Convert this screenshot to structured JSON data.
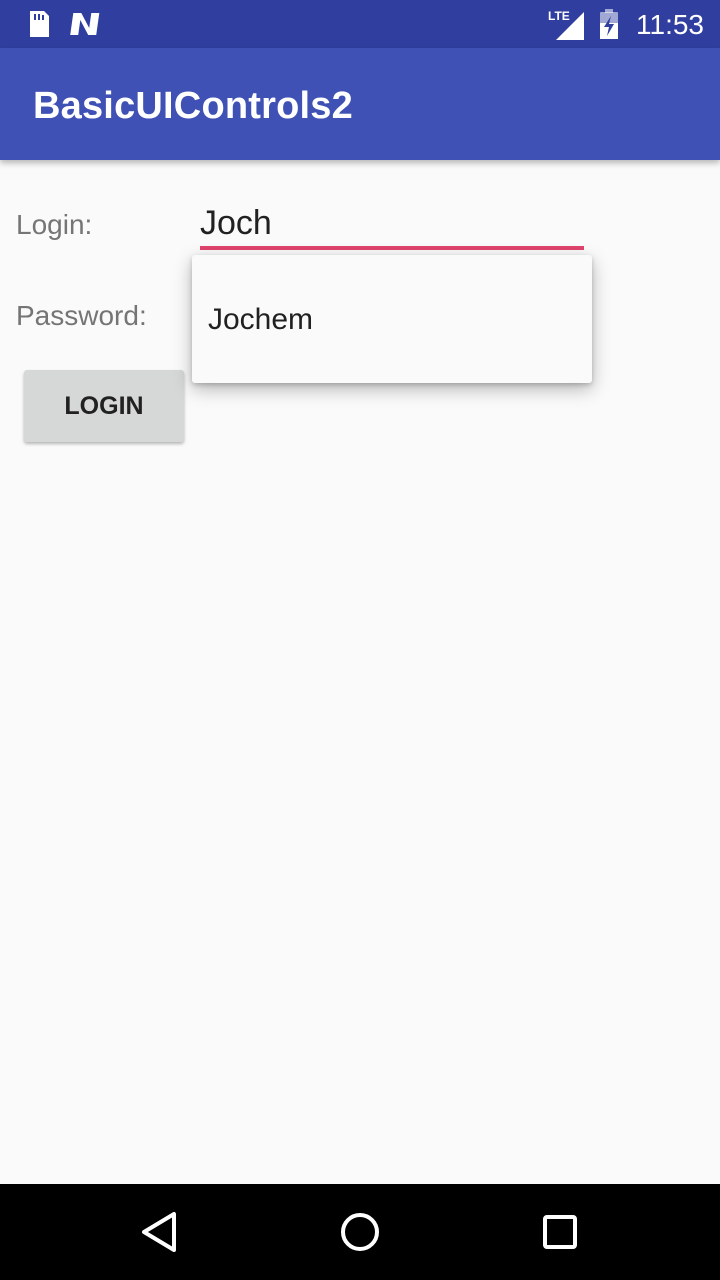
{
  "status_bar": {
    "time": "11:53",
    "network_label": "LTE",
    "icons": [
      "sd-card-icon",
      "n-notification-icon",
      "lte-signal-icon",
      "battery-charging-icon"
    ]
  },
  "app_bar": {
    "title": "BasicUIControls2"
  },
  "form": {
    "login_label": "Login:",
    "login_value": "Joch",
    "password_label": "Password:",
    "login_button_label": "LOGIN"
  },
  "autocomplete": {
    "suggestions": [
      "Jochem"
    ]
  },
  "nav_bar": {
    "buttons": [
      "back-icon",
      "home-icon",
      "recents-icon"
    ]
  },
  "colors": {
    "status_bar": "#303f9f",
    "app_bar": "#3f51b5",
    "accent_underline": "#e0446d",
    "background": "#fafafa",
    "button": "#d6d7d7"
  }
}
